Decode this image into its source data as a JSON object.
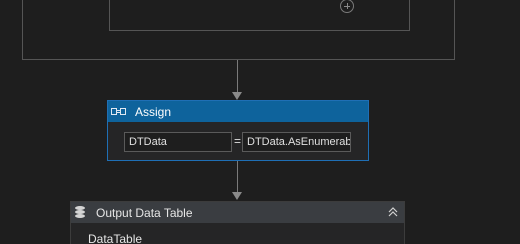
{
  "assign": {
    "title": "Assign",
    "to_value": "DTData",
    "equals": "=",
    "value_expression": "DTData.AsEnumerable"
  },
  "output_data_table": {
    "title": "Output Data Table",
    "property_label": "DataTable"
  },
  "icons": {
    "add": "plus-circle-icon",
    "assign": "assign-icon",
    "database": "database-icon",
    "collapse": "chevron-double-up-icon"
  },
  "colors": {
    "background": "#1e1e1e",
    "assign_header": "#0e639c",
    "assign_border": "#1f6fb5",
    "odt_header": "#3a3d41"
  }
}
